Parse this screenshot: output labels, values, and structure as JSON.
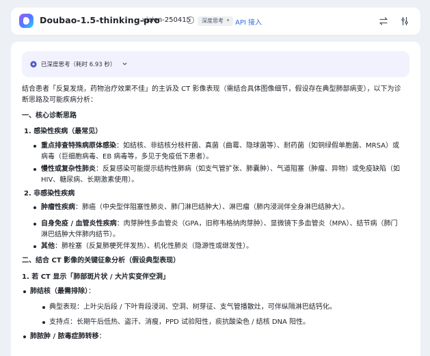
{
  "header": {
    "model_name": "Doubao-1.5-thinking-pro",
    "model_version": "vision-250415",
    "info_icon": "info-icon",
    "mode_tag": "深度思考",
    "api_link": "API 接入",
    "actions": [
      {
        "icon": "swap-icon"
      },
      {
        "icon": "tune-icon"
      }
    ]
  },
  "thinking": {
    "label": "已深度思考（耗时 6.93 秒）",
    "icon": "sparkle-icon",
    "toggle_icon": "chevron-down-icon"
  },
  "answer": {
    "intro_1": "结合患者「反复发烧，药物治疗效果不佳」的主诉及 CT 影像表现（需结合具体图像细节，假设存在典型肺部病变），以下为诊",
    "intro_2": "断思路及可能疾病分析：",
    "section1_title": "一、核心诊断思路",
    "sub1_title": "1. 感染性疾病（最常见）",
    "sub1_items": [
      {
        "head": "重点排查特殊病原体感染",
        "text_1": "：如结核、非结核分枝杆菌、真菌（曲霉、隐球菌等）、耐药菌（如铜绿假单胞菌、MRSA）或",
        "text_2": "病毒（巨细胞病毒、EB 病毒等，多见于免疫低下患者）。"
      },
      {
        "head": "慢性或复杂性肺炎",
        "text_1": "：反复感染可能提示结构性肺病（如支气管扩张、肺囊肿）、气道阻塞（肿瘤、异物）或免疫缺陷（如",
        "text_2": "HIV、糖尿病、长期激素使用）。"
      }
    ],
    "sub2_title": "2. 非感染性疾病",
    "sub2_items": [
      {
        "head": "肿瘤性疾病",
        "text_1": "：肺癌（中央型伴阻塞性肺炎、肺门淋巴结肿大）、淋巴瘤（肺内浸润伴全身淋巴结肿大）。"
      },
      {
        "head": "自身免疫 / 血管炎性疾病",
        "text_1": "：肉芽肿性多血管炎（GPA，旧称韦格纳肉芽肿）、显微镜下多血管炎（MPA）、结节病（肺门",
        "text_2": "淋巴结肿大伴肺内结节）。"
      },
      {
        "head": "其他",
        "text_1": "：肺栓塞（反复肺梗死伴发热）、机化性肺炎（隐源性或继发性）。"
      }
    ],
    "section2_title": "二、结合 CT 影像的关键征象分析（假设典型表现）",
    "sub3_title": "1. 若 CT 显示「肺部斑片状 / 大片实变伴空洞」",
    "tb_title": "肺结核（最需排除）",
    "tb_title_suffix": "：",
    "tb_points": [
      "典型表现：上叶尖后段 / 下叶背段浸润、空洞、树芽征、支气管播散灶，可伴纵隔淋巴结钙化。",
      "支持点：长期午后低热、盗汗、消瘦，PPD 试验阳性，痰抗酸染色 / 结核 DNA 阳性。"
    ],
    "abscess_title": "肺脓肿 / 脓毒症肺转移",
    "abscess_suffix": "："
  }
}
